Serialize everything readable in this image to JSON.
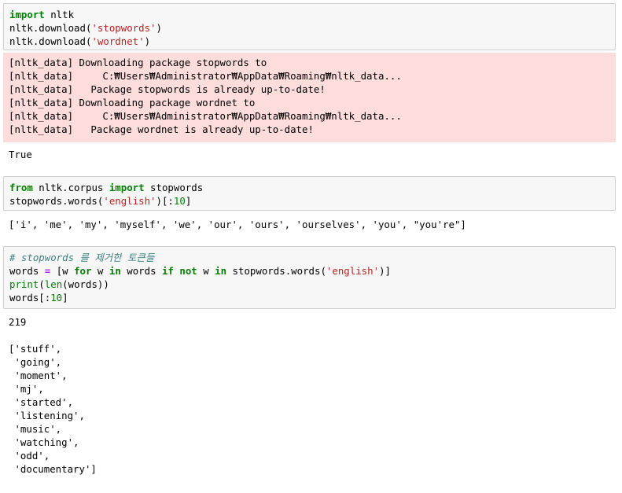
{
  "cells": [
    {
      "input": [
        [
          {
            "t": "import",
            "c": "kw"
          },
          {
            "t": " nltk"
          }
        ],
        [
          {
            "t": "nltk.download("
          },
          {
            "t": "'stopwords'",
            "c": "str"
          },
          {
            "t": ")"
          }
        ],
        [
          {
            "t": "nltk.download("
          },
          {
            "t": "'wordnet'",
            "c": "str"
          },
          {
            "t": ")"
          }
        ]
      ],
      "stderr": [
        "[nltk_data] Downloading package stopwords to",
        "[nltk_data]     C:₩Users₩Administrator₩AppData₩Roaming₩nltk_data...",
        "[nltk_data]   Package stopwords is already up-to-date!",
        "[nltk_data] Downloading package wordnet to",
        "[nltk_data]     C:₩Users₩Administrator₩AppData₩Roaming₩nltk_data...",
        "[nltk_data]   Package wordnet is already up-to-date!"
      ],
      "output": [
        "True"
      ]
    },
    {
      "input": [
        [
          {
            "t": "from",
            "c": "kw"
          },
          {
            "t": " nltk.corpus "
          },
          {
            "t": "import",
            "c": "kw"
          },
          {
            "t": " stopwords"
          }
        ],
        [
          {
            "t": "stopwords.words("
          },
          {
            "t": "'english'",
            "c": "str"
          },
          {
            "t": ")[:"
          },
          {
            "t": "10",
            "c": "num"
          },
          {
            "t": "]"
          }
        ]
      ],
      "output": [
        "['i', 'me', 'my', 'myself', 'we', 'our', 'ours', 'ourselves', 'you', \"you're\"]"
      ]
    },
    {
      "input": [
        [
          {
            "t": "# stopwords 를 제거한 토큰들",
            "c": "cm"
          }
        ],
        [
          {
            "t": "words "
          },
          {
            "t": "=",
            "c": "op"
          },
          {
            "t": " [w "
          },
          {
            "t": "for",
            "c": "kw"
          },
          {
            "t": " w "
          },
          {
            "t": "in",
            "c": "kw"
          },
          {
            "t": " words "
          },
          {
            "t": "if",
            "c": "kw"
          },
          {
            "t": " "
          },
          {
            "t": "not",
            "c": "kw"
          },
          {
            "t": " w "
          },
          {
            "t": "in",
            "c": "kw"
          },
          {
            "t": " stopwords.words("
          },
          {
            "t": "'english'",
            "c": "str"
          },
          {
            "t": ")]"
          }
        ],
        [
          {
            "t": "print",
            "c": "bi"
          },
          {
            "t": "("
          },
          {
            "t": "len",
            "c": "bi"
          },
          {
            "t": "(words))"
          }
        ],
        [
          {
            "t": "words[:"
          },
          {
            "t": "10",
            "c": "num"
          },
          {
            "t": "]"
          }
        ]
      ],
      "output": [
        "219",
        "",
        "['stuff',",
        " 'going',",
        " 'moment',",
        " 'mj',",
        " 'started',",
        " 'listening',",
        " 'music',",
        " 'watching',",
        " 'odd',",
        " 'documentary']"
      ]
    }
  ]
}
